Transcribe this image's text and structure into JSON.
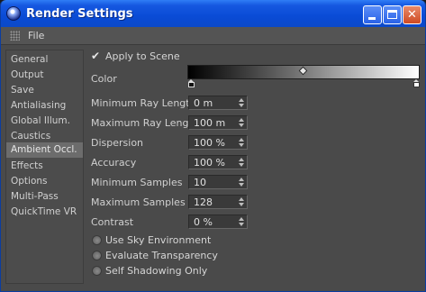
{
  "window": {
    "title": "Render Settings"
  },
  "menu": {
    "file": "File"
  },
  "sidebar": {
    "items": [
      {
        "label": "General"
      },
      {
        "label": "Output"
      },
      {
        "label": "Save"
      },
      {
        "label": "Antialiasing"
      },
      {
        "label": "Global Illum."
      },
      {
        "label": "Caustics"
      },
      {
        "label": "Ambient Occl."
      },
      {
        "label": "Effects"
      },
      {
        "label": "Options"
      },
      {
        "label": "Multi-Pass"
      },
      {
        "label": "QuickTime VR"
      }
    ],
    "selected": "Ambient Occl."
  },
  "ao": {
    "apply_to_scene": {
      "label": "Apply to Scene",
      "checked": true
    },
    "color": {
      "label": "Color"
    },
    "fields": [
      {
        "label": "Minimum Ray Length",
        "value": "0 m"
      },
      {
        "label": "Maximum Ray Length",
        "value": "100 m"
      },
      {
        "label": "Dispersion",
        "value": "100 %"
      },
      {
        "label": "Accuracy",
        "value": "100 %"
      },
      {
        "label": "Minimum Samples",
        "value": "10"
      },
      {
        "label": "Maximum Samples",
        "value": "128"
      },
      {
        "label": "Contrast",
        "value": "0 %"
      }
    ],
    "options": [
      {
        "label": "Use Sky Environment",
        "checked": false
      },
      {
        "label": "Evaluate Transparency",
        "checked": false
      },
      {
        "label": "Self Shadowing Only",
        "checked": false
      }
    ]
  }
}
